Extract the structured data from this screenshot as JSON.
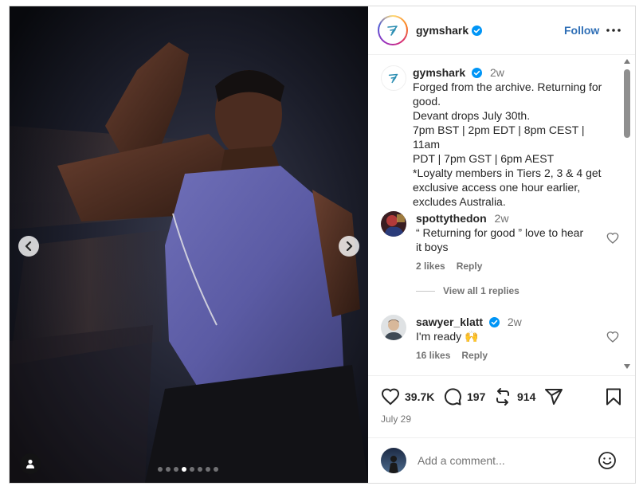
{
  "post": {
    "account": "gymshark",
    "follow_label": "Follow",
    "carousel": {
      "slide_count": 8,
      "active_index": 3
    }
  },
  "caption": {
    "username": "gymshark",
    "time": "2w",
    "lines": [
      "Forged from the archive. Returning for",
      "good.",
      "Devant drops July 30th.",
      "7pm BST | 2pm EDT | 8pm CEST | 11am",
      "PDT | 7pm GST | 6pm AEST",
      "*Loyalty members in Tiers 2, 3 & 4 get",
      "exclusive access one hour earlier,",
      "excludes Australia."
    ]
  },
  "comments": [
    {
      "username": "spottythedon",
      "verified": false,
      "time": "2w",
      "lines": [
        "“ Returning for good ” love to hear",
        "it boys"
      ],
      "likes": "2 likes",
      "reply_label": "Reply",
      "view_replies": "View all 1 replies"
    },
    {
      "username": "sawyer_klatt",
      "verified": true,
      "time": "2w",
      "text": "I'm ready 🙌",
      "likes": "16 likes",
      "reply_label": "Reply"
    }
  ],
  "actions": {
    "likes": "39.7K",
    "comments": "197",
    "reposts": "914",
    "date": "July 29"
  },
  "add_comment": {
    "placeholder": "Add a comment..."
  },
  "colors": {
    "accent": "#2f6fb6",
    "verified": "#0095f6",
    "text": "#262626",
    "muted": "#737373"
  },
  "icons": [
    "chevron-left-icon",
    "chevron-right-icon",
    "user-tag-icon",
    "verified-icon",
    "more-icon",
    "heart-icon",
    "comment-icon",
    "repost-icon",
    "share-icon",
    "bookmark-icon",
    "emoji-icon"
  ]
}
